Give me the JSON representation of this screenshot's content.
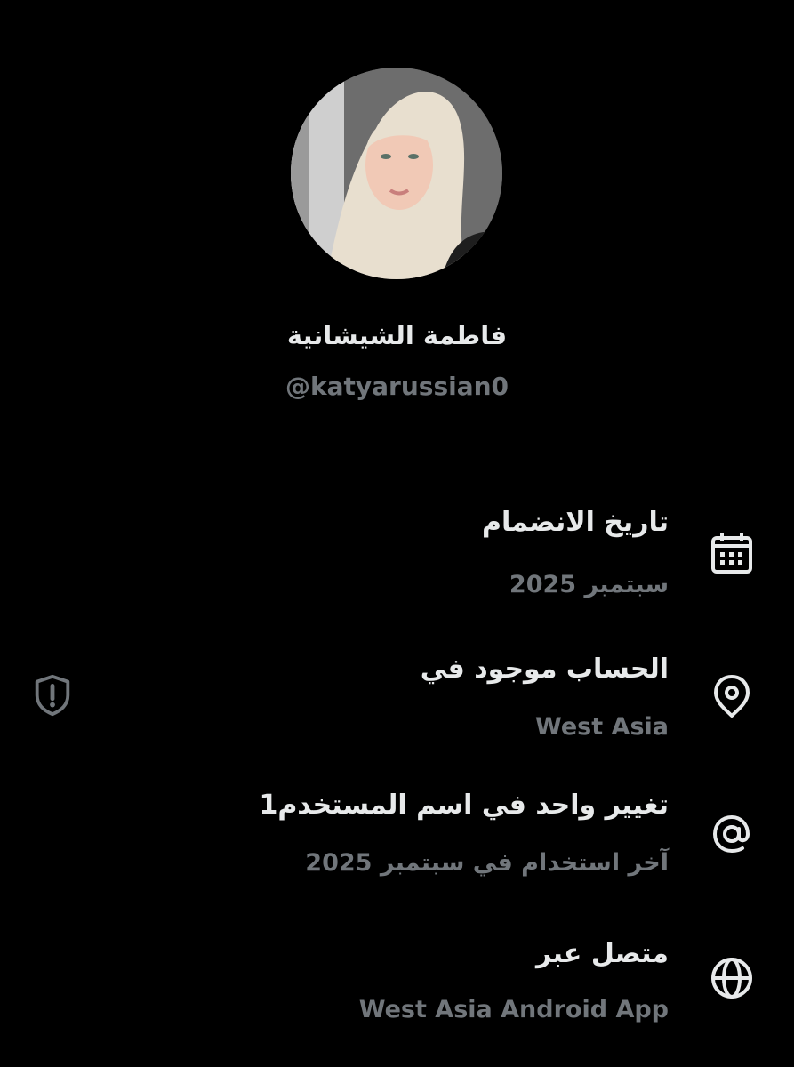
{
  "profile": {
    "display_name": "فاطمة الشيشانية",
    "handle": "@katyarussian0"
  },
  "about": {
    "joined": {
      "title": "تاريخ الانضمام",
      "value": "سبتمبر 2025",
      "icon": "calendar-icon"
    },
    "location": {
      "title": "الحساب موجود في",
      "value": "West Asia",
      "icon": "location-pin-icon",
      "badge_icon": "shield-alert-icon"
    },
    "username_changes": {
      "title": "تغيير واحد في اسم المستخدم1",
      "value": "آخر استخدام في سبتمبر 2025",
      "icon": "at-sign-icon"
    },
    "connected_via": {
      "title": "متصل عبر",
      "value": "West Asia Android App",
      "icon": "globe-icon"
    }
  },
  "colors": {
    "background": "#000000",
    "primary_text": "#e7e9ea",
    "secondary_text": "#71767b"
  }
}
